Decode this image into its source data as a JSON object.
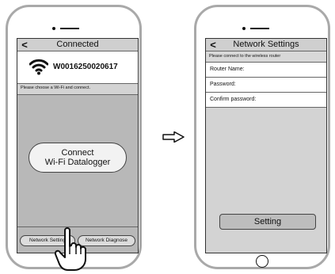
{
  "left_screen": {
    "title": "Connected",
    "back_glyph": "<",
    "device_id": "W0016250020617",
    "hint": "Please choose a Wi-Fi and connect.",
    "connect_button": {
      "line1": "Connect",
      "line2": "Wi-Fi Datalogger"
    },
    "bottom_buttons": [
      "Network Setting",
      "Network Diagnose"
    ]
  },
  "right_screen": {
    "title": "Network Settings",
    "back_glyph": "<",
    "hint": "Please connect to the wireless router",
    "fields": [
      "Router Name:",
      "Password:",
      "Confirm password:"
    ],
    "setting_button": "Setting"
  },
  "icons": {
    "wifi": "wifi-icon",
    "hand": "pointing-hand-icon",
    "arrow": "right-arrow-icon"
  },
  "colors": {
    "phone_frame": "#a9a9a9",
    "nav_bar": "#cfcfcf",
    "content_gray": "#b8b8b8",
    "light_gray": "#d3d3d3"
  }
}
